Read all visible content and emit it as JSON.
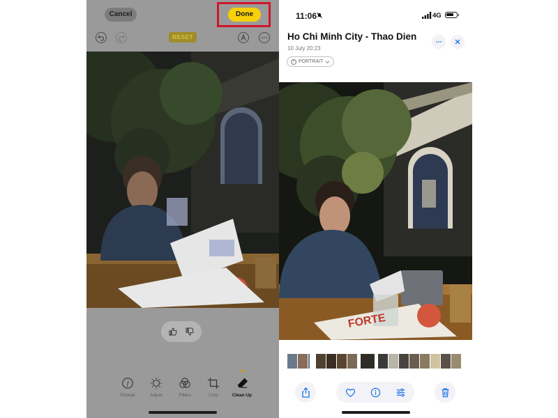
{
  "left_screen": {
    "cancel_label": "Cancel",
    "done_label": "Done",
    "reset_label": "RESET",
    "toolbar_icons": [
      "undo-icon",
      "redo-icon",
      "markup-icon",
      "more-icon"
    ],
    "feedback_icons": [
      "thumbs-up-icon",
      "thumbs-down-icon"
    ],
    "edit_tools": [
      {
        "label": "Portrait",
        "icon": "portrait-f-icon"
      },
      {
        "label": "Adjust",
        "icon": "adjust-dial-icon"
      },
      {
        "label": "Filters",
        "icon": "filters-icon"
      },
      {
        "label": "Crop",
        "icon": "crop-icon"
      },
      {
        "label": "Clean Up",
        "icon": "eraser-icon",
        "selected": true
      }
    ],
    "highlight_color": "#d0152a",
    "done_color": "#f7cf0a"
  },
  "right_screen": {
    "status_bar": {
      "time": "11:06",
      "network": "4G"
    },
    "title": "Ho Chi Minh City - Thao Dien",
    "date": "10 July  20:23",
    "portrait_badge": "PORTRAIT",
    "bottom_icons": [
      "share-icon",
      "heart-icon",
      "info-icon",
      "adjust-icon",
      "trash-icon"
    ],
    "accent_color": "#1a73e8"
  }
}
